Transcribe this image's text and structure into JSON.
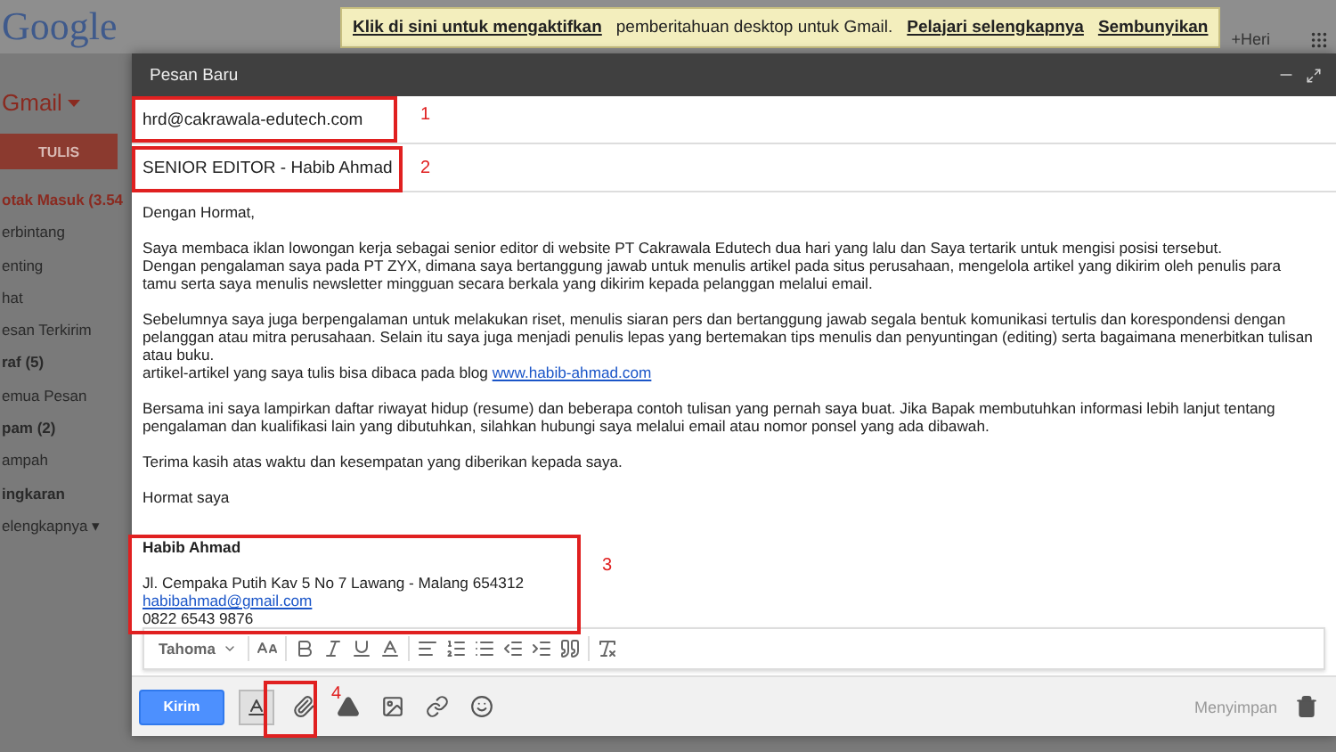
{
  "header": {
    "logo": "Google",
    "notification": {
      "link": "Klik di sini untuk mengaktifkan",
      "text": "pemberitahuan desktop untuk Gmail.",
      "actions": [
        "Pelajari selengkapnya",
        "Sembunyikan"
      ]
    },
    "user": "+Heri"
  },
  "sidebar": {
    "app": "Gmail",
    "compose_button": "TULIS",
    "items": [
      {
        "label": "otak Masuk (3.54",
        "selected": true,
        "bold": true
      },
      {
        "label": "erbintang",
        "selected": false,
        "bold": false
      },
      {
        "label": "enting",
        "selected": false,
        "bold": false
      },
      {
        "label": "hat",
        "selected": false,
        "bold": false
      },
      {
        "label": "esan Terkirim",
        "selected": false,
        "bold": false
      },
      {
        "label": "raf (5)",
        "selected": false,
        "bold": true
      },
      {
        "label": "emua Pesan",
        "selected": false,
        "bold": false
      },
      {
        "label": "pam (2)",
        "selected": false,
        "bold": true
      },
      {
        "label": "ampah",
        "selected": false,
        "bold": false
      },
      {
        "label": "ingkaran",
        "selected": false,
        "bold": true
      },
      {
        "label": "elengkapnya ▾",
        "selected": false,
        "bold": false
      }
    ]
  },
  "compose": {
    "title": "Pesan Baru",
    "to": "hrd@cakrawala-edutech.com",
    "subject": "SENIOR EDITOR - Habib Ahmad",
    "body": [
      {
        "lines": [
          {
            "text": "Dengan Hormat,"
          }
        ]
      },
      {
        "lines": [
          {
            "text": "Saya membaca iklan lowongan kerja sebagai senior editor di website PT Cakrawala Edutech dua hari yang lalu dan Saya tertarik untuk mengisi posisi tersebut."
          },
          {
            "text": "Dengan pengalaman saya pada PT ZYX, dimana saya bertanggung jawab untuk menulis artikel pada situs perusahaan, mengelola artikel yang dikirim oleh penulis para tamu serta saya menulis newsletter mingguan secara berkala yang dikirim kepada pelanggan melalui email."
          }
        ]
      },
      {
        "lines": [
          {
            "text": "Sebelumnya saya juga berpengalaman untuk melakukan riset, menulis siaran pers dan bertanggung jawab segala bentuk komunikasi tertulis dan korespondensi dengan pelanggan atau mitra perusahaan. Selain itu saya juga menjadi penulis lepas yang bertemakan tips menulis dan penyuntingan (editing) serta bagaimana menerbitkan tulisan atau buku."
          },
          {
            "text": "artikel-artikel yang saya tulis bisa dibaca pada blog",
            "link": "www.habib-ahmad.com"
          }
        ]
      },
      {
        "lines": [
          {
            "text": "Bersama ini saya lampirkan daftar riwayat hidup (resume) dan beberapa contoh tulisan yang pernah saya buat. Jika Bapak membutuhkan informasi lebih lanjut tentang pengalaman dan kualifikasi lain yang dibutuhkan, silahkan hubungi saya melalui email atau nomor ponsel yang ada dibawah."
          }
        ]
      },
      {
        "lines": [
          {
            "text": "Terima kasih atas waktu dan kesempatan yang diberikan kepada saya."
          }
        ]
      },
      {
        "lines": [
          {
            "text": "Hormat saya"
          }
        ]
      }
    ],
    "signature": {
      "name": "Habib Ahmad",
      "address": "Jl. Cempaka Putih Kav 5 No 7 Lawang - Malang 654312",
      "email": "habibahmad@gmail.com",
      "phone": "0822 6543 9876"
    },
    "toolbar": {
      "font": "Tahoma"
    },
    "send": "Kirim",
    "formatting_on": true,
    "status": "Menyimpan",
    "annotations": [
      {
        "number": "1"
      },
      {
        "number": "2"
      },
      {
        "number": "3"
      },
      {
        "number": "4"
      }
    ]
  }
}
